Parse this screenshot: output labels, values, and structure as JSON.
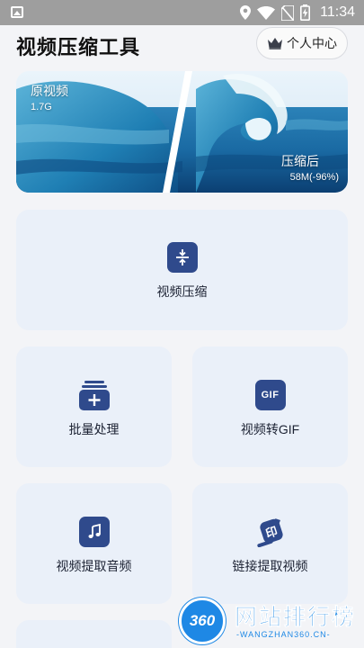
{
  "status_bar": {
    "time": "11:34"
  },
  "header": {
    "title": "视频压缩工具",
    "personal_center": "个人中心"
  },
  "banner": {
    "original_label": "原视频",
    "original_size": "1.7G",
    "compressed_label": "压缩后",
    "compressed_size": "58M(-96%)"
  },
  "features": {
    "compress": "视频压缩",
    "batch": "批量处理",
    "to_gif": "视频转GIF",
    "extract_audio": "视频提取音频",
    "link_extract": "链接提取视频"
  },
  "icons": {
    "gif_icon_text": "GIF",
    "link_icon_text": "印"
  },
  "watermark": {
    "logo": "360",
    "text": "网站排行榜",
    "sub": "-WANGZHAN360.CN-"
  },
  "colors": {
    "accent": "#2f4a8c",
    "card_bg": "#eaf0f9",
    "watermark": "#1e88e5"
  }
}
